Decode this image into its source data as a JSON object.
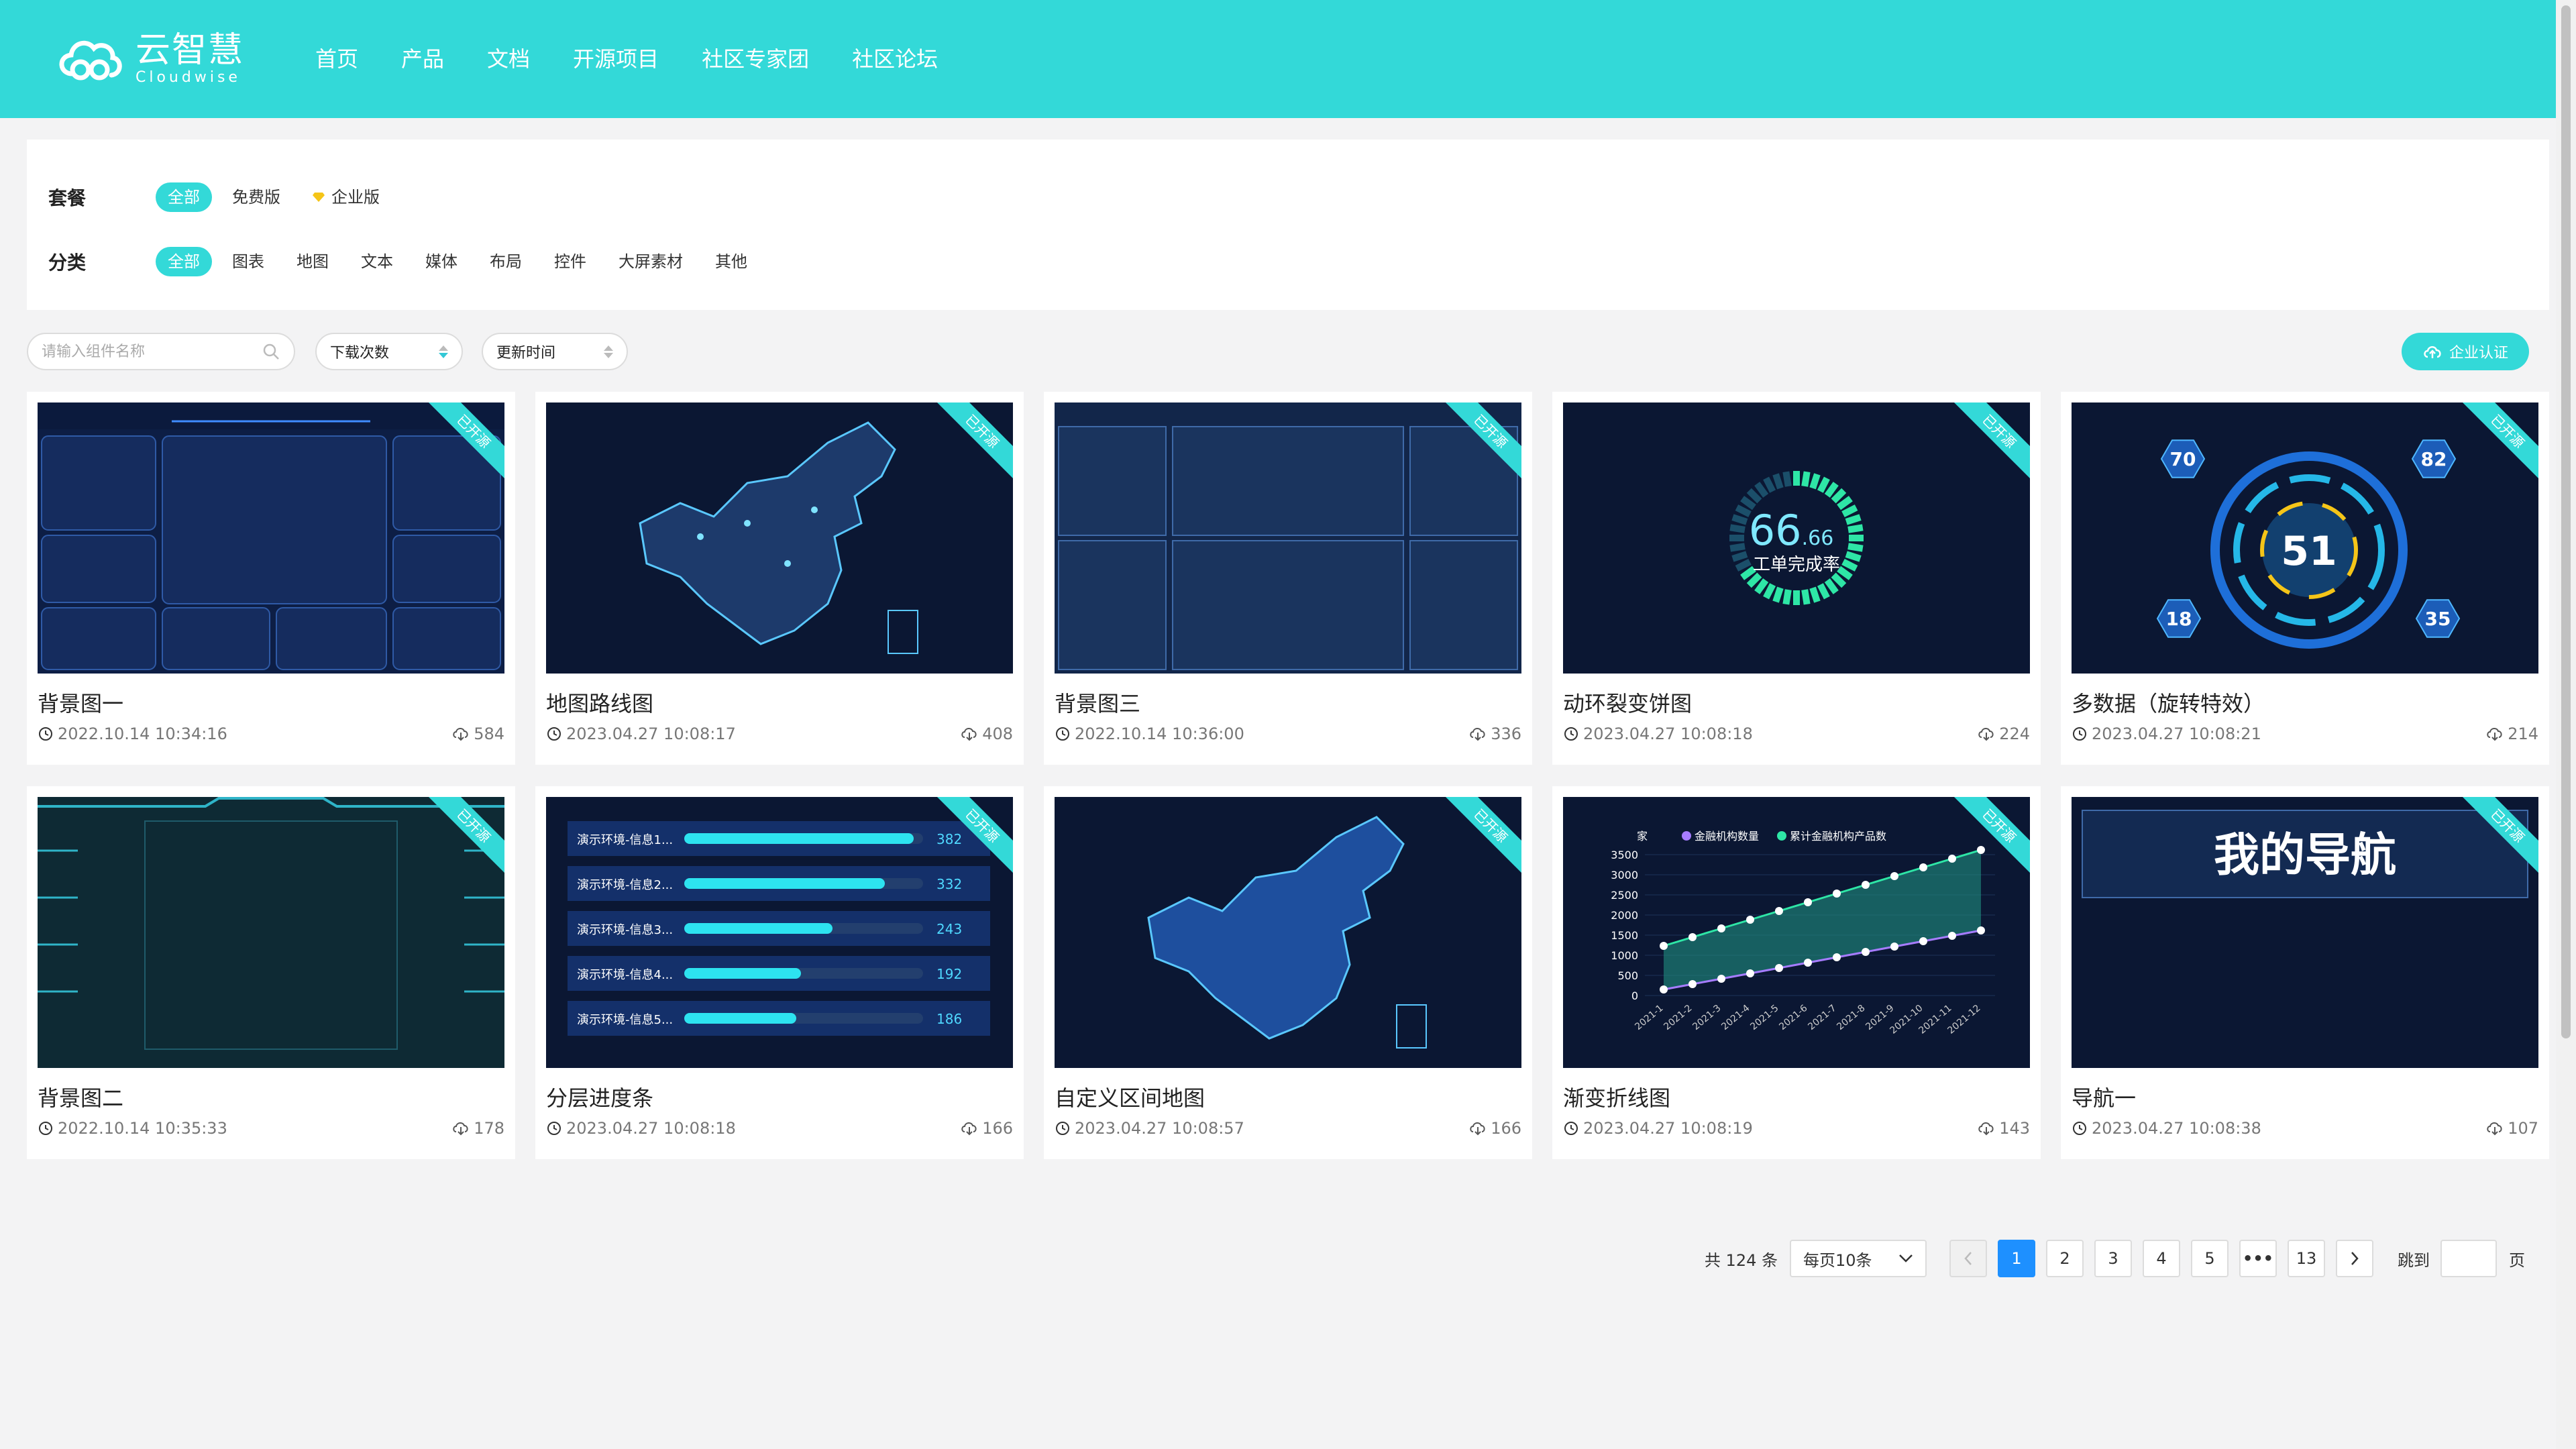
{
  "header": {
    "logo_cn": "云智慧",
    "logo_en": "Cloudwise",
    "nav": [
      "首页",
      "产品",
      "文档",
      "开源项目",
      "社区专家团",
      "社区论坛"
    ]
  },
  "filters": {
    "package": {
      "label": "套餐",
      "options": [
        "全部",
        "免费版",
        "企业版"
      ],
      "active": 0
    },
    "category": {
      "label": "分类",
      "options": [
        "全部",
        "图表",
        "地图",
        "文本",
        "媒体",
        "布局",
        "控件",
        "大屏素材",
        "其他"
      ],
      "active": 0
    }
  },
  "toolbar": {
    "search_placeholder": "请输入组件名称",
    "sort_downloads": "下载次数",
    "sort_updated": "更新时间",
    "cert_button": "企业认证"
  },
  "ribbon_label": "已开源",
  "cards": [
    {
      "title": "背景图一",
      "time": "2022.10.14 10:34:16",
      "downloads": "584",
      "thumb": "bg1"
    },
    {
      "title": "地图路线图",
      "time": "2023.04.27 10:08:17",
      "downloads": "408",
      "thumb": "map1"
    },
    {
      "title": "背景图三",
      "time": "2022.10.14 10:36:00",
      "downloads": "336",
      "thumb": "bg3"
    },
    {
      "title": "动环裂变饼图",
      "time": "2023.04.27 10:08:18",
      "downloads": "224",
      "thumb": "ring"
    },
    {
      "title": "多数据（旋转特效）",
      "time": "2023.04.27 10:08:21",
      "downloads": "214",
      "thumb": "multi"
    },
    {
      "title": "背景图二",
      "time": "2022.10.14 10:35:33",
      "downloads": "178",
      "thumb": "bg2"
    },
    {
      "title": "分层进度条",
      "time": "2023.04.27 10:08:18",
      "downloads": "166",
      "thumb": "bars"
    },
    {
      "title": "自定义区间地图",
      "time": "2023.04.27 10:08:57",
      "downloads": "166",
      "thumb": "map2"
    },
    {
      "title": "渐变折线图",
      "time": "2023.04.27 10:08:19",
      "downloads": "143",
      "thumb": "line"
    },
    {
      "title": "导航一",
      "time": "2023.04.27 10:08:38",
      "downloads": "107",
      "thumb": "nav"
    }
  ],
  "thumb_text": {
    "ring_value": "66",
    "ring_decimal": ".66",
    "ring_label": "工单完成率",
    "multi_center": "51",
    "multi_values": [
      "70",
      "82",
      "18",
      "35"
    ],
    "bars_labels": [
      "演示环境-信息1...",
      "演示环境-信息2...",
      "演示环境-信息3...",
      "演示环境-信息4...",
      "演示环境-信息5..."
    ],
    "bars_values": [
      "382",
      "332",
      "243",
      "192",
      "186"
    ],
    "bars_fractions": [
      0.96,
      0.84,
      0.62,
      0.49,
      0.47
    ],
    "line_unit": "家",
    "line_legend": [
      "金融机构数量",
      "累计金融机构产品数"
    ],
    "line_yticks": [
      "3500",
      "3000",
      "2500",
      "2000",
      "1500",
      "1000",
      "500",
      "0"
    ],
    "line_xticks": [
      "2021-1",
      "2021-2",
      "2021-3",
      "2021-4",
      "2021-5",
      "2021-6",
      "2021-7",
      "2021-8",
      "2021-9",
      "2021-10",
      "2021-11",
      "2021-12"
    ],
    "nav_title": "我的导航"
  },
  "pagination": {
    "total": "共 124 条",
    "page_size": "每页10条",
    "pages": [
      "1",
      "2",
      "3",
      "4",
      "5",
      "•••",
      "13"
    ],
    "active_page": "1",
    "jump_label": "跳到",
    "page_suffix": "页"
  }
}
